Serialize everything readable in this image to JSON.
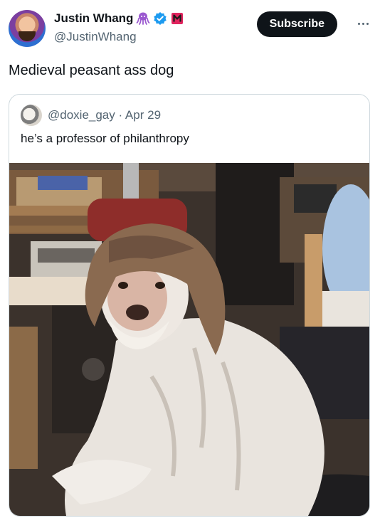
{
  "author": {
    "display_name": "Justin Whang",
    "handle": "@JustinWhang",
    "badges": [
      "octopus-icon",
      "verified-icon",
      "m-badge-icon"
    ],
    "badge_colors": {
      "octopus": "#9b59d0",
      "verified": "#1d9bf0",
      "m_badge": "#e0245e"
    }
  },
  "subscribe_label": "Subscribe",
  "tweet_text": "Medieval peasant ass dog",
  "quote": {
    "handle_line": "@doxie_gay · Apr 29",
    "text": "he’s a professor of philanthropy",
    "media_icon": "photo-dog-with-bangs"
  },
  "colors": {
    "text": "#0f1419",
    "secondary": "#536471",
    "border": "#cfd9de",
    "button_bg": "#0f1419"
  }
}
